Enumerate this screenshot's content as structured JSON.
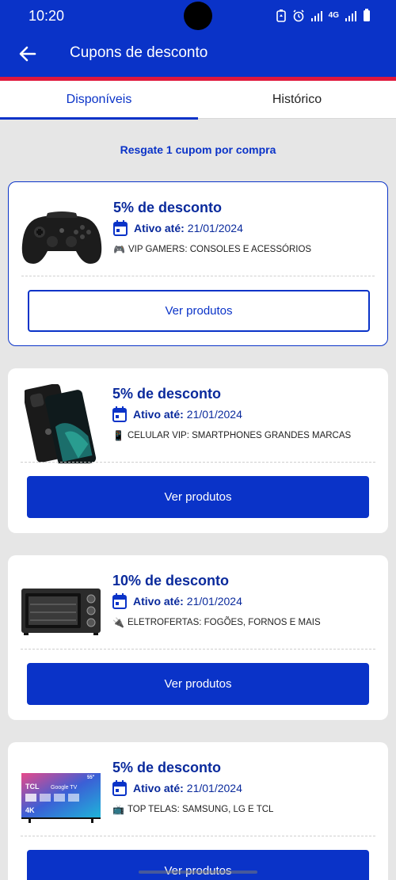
{
  "status_bar": {
    "time": "10:20",
    "network": "4G"
  },
  "header": {
    "title": "Cupons de desconto"
  },
  "tabs": [
    {
      "label": "Disponíveis",
      "active": true
    },
    {
      "label": "Histórico",
      "active": false
    }
  ],
  "hint": "Resgate 1 cupom por compra",
  "date_label": "Ativo até:",
  "coupons": [
    {
      "title": "5% de desconto",
      "date": "21/01/2024",
      "emoji": "🎮",
      "category": "VIP GAMERS: CONSOLES E ACESSÓRIOS",
      "button": "Ver produtos",
      "image": "game-controller-image"
    },
    {
      "title": "5% de desconto",
      "date": "21/01/2024",
      "emoji": "📱",
      "category": "CELULAR VIP: SMARTPHONES GRANDES MARCAS",
      "button": "Ver produtos",
      "image": "smartphone-image"
    },
    {
      "title": "10% de desconto",
      "date": "21/01/2024",
      "emoji": "🔌",
      "category": "ELETROFERTAS: FOGÕES, FORNOS E MAIS",
      "button": "Ver produtos",
      "image": "electric-oven-image"
    },
    {
      "title": "5% de desconto",
      "date": "21/01/2024",
      "emoji": "📺",
      "category": "TOP TELAS: SAMSUNG, LG E TCL",
      "button": "Ver produtos",
      "image": "tv-image",
      "tv_brand": "TCL",
      "tv_os": "Google TV",
      "tv_res": "4K",
      "tv_size": "55\""
    }
  ],
  "colors": {
    "primary": "#0a33c8",
    "accent_red": "#e0173c",
    "title_blue": "#0a2a9c",
    "background": "#e6e6e6"
  }
}
